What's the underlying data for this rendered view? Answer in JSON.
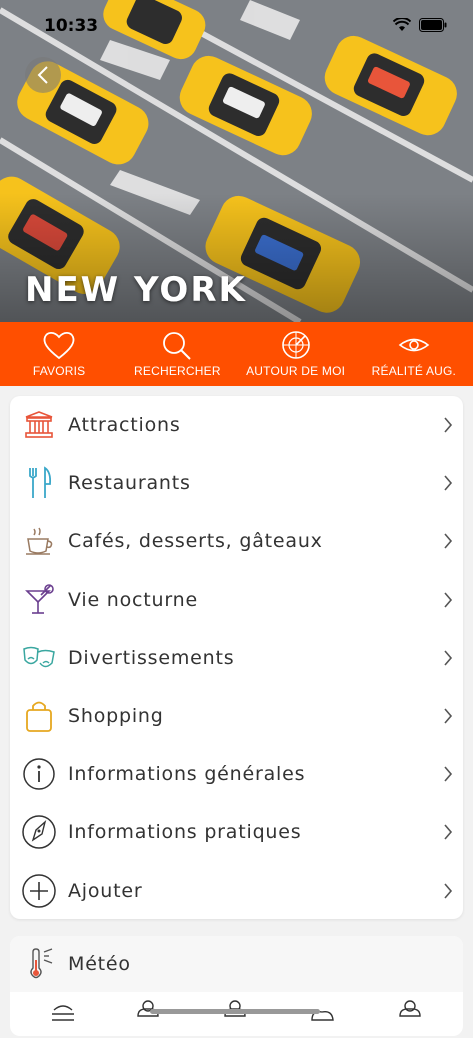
{
  "status": {
    "time": "10:33"
  },
  "hero": {
    "city": "NEW YORK"
  },
  "toolbar": {
    "items": [
      {
        "label": "FAVORIS",
        "icon": "heart-icon"
      },
      {
        "label": "RECHERCHER",
        "icon": "search-icon"
      },
      {
        "label": "AUTOUR DE MOI",
        "icon": "radar-icon"
      },
      {
        "label": "RÉALITÉ AUG.",
        "icon": "eye-icon"
      }
    ]
  },
  "menu": {
    "items": [
      {
        "label": "Attractions",
        "icon": "monument-icon",
        "color": "#e8553a"
      },
      {
        "label": "Restaurants",
        "icon": "fork-knife-icon",
        "color": "#3aa7c9"
      },
      {
        "label": "Cafés, desserts, gâteaux",
        "icon": "coffee-cup-icon",
        "color": "#9a7b62"
      },
      {
        "label": "Vie nocturne",
        "icon": "cocktail-icon",
        "color": "#6b3f8f"
      },
      {
        "label": "Divertissements",
        "icon": "theater-masks-icon",
        "color": "#3aa7a0"
      },
      {
        "label": "Shopping",
        "icon": "shopping-bag-icon",
        "color": "#e6a820"
      },
      {
        "label": "Informations générales",
        "icon": "info-icon",
        "color": "#333333"
      },
      {
        "label": "Informations pratiques",
        "icon": "compass-icon",
        "color": "#333333"
      },
      {
        "label": "Ajouter",
        "icon": "plus-circle-icon",
        "color": "#333333"
      }
    ]
  },
  "weather": {
    "title": "Météo",
    "icon": "thermometer-icon"
  },
  "colors": {
    "accent": "#ff4f00",
    "taxi": "#f6c21c"
  }
}
